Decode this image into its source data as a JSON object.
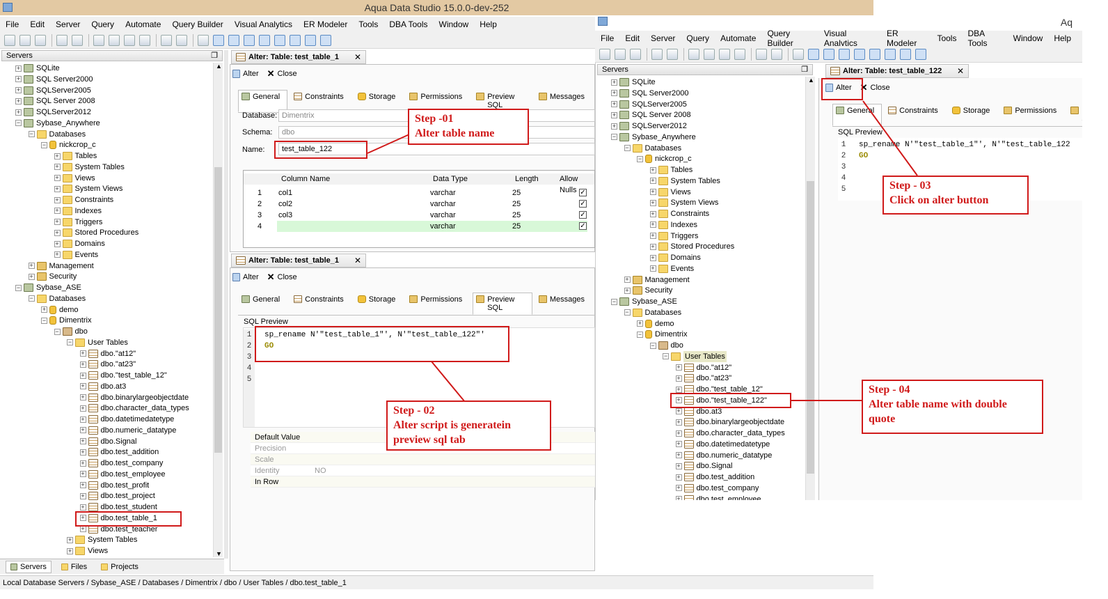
{
  "window_title": "Aqua Data Studio 15.0.0-dev-252",
  "window_title_right": "Aq",
  "menu": [
    "File",
    "Edit",
    "Server",
    "Query",
    "Automate",
    "Query Builder",
    "Visual Analytics",
    "ER Modeler",
    "Tools",
    "DBA Tools",
    "Window",
    "Help"
  ],
  "servers_panel_title": "Servers",
  "tree_left": [
    {
      "d": 0,
      "t": "SQLite",
      "i": "srv"
    },
    {
      "d": 0,
      "t": "SQL Server2000",
      "i": "srv"
    },
    {
      "d": 0,
      "t": "SQLServer2005",
      "i": "srv"
    },
    {
      "d": 0,
      "t": "SQL Server 2008",
      "i": "srv"
    },
    {
      "d": 0,
      "t": "SQLServer2012",
      "i": "srv"
    },
    {
      "d": 0,
      "t": "Sybase_Anywhere",
      "i": "srv",
      "open": true
    },
    {
      "d": 1,
      "t": "Databases",
      "i": "fld",
      "open": true
    },
    {
      "d": 2,
      "t": "nickcrop_c",
      "i": "db",
      "open": true
    },
    {
      "d": 3,
      "t": "Tables",
      "i": "fld"
    },
    {
      "d": 3,
      "t": "System Tables",
      "i": "fld"
    },
    {
      "d": 3,
      "t": "Views",
      "i": "fld"
    },
    {
      "d": 3,
      "t": "System Views",
      "i": "fld"
    },
    {
      "d": 3,
      "t": "Constraints",
      "i": "fld"
    },
    {
      "d": 3,
      "t": "Indexes",
      "i": "fld"
    },
    {
      "d": 3,
      "t": "Triggers",
      "i": "fld"
    },
    {
      "d": 3,
      "t": "Stored Procedures",
      "i": "fld"
    },
    {
      "d": 3,
      "t": "Domains",
      "i": "fld"
    },
    {
      "d": 3,
      "t": "Events",
      "i": "fld"
    },
    {
      "d": 1,
      "t": "Management",
      "i": "mgmt"
    },
    {
      "d": 1,
      "t": "Security",
      "i": "mgmt"
    },
    {
      "d": 0,
      "t": "Sybase_ASE",
      "i": "srv",
      "open": true
    },
    {
      "d": 1,
      "t": "Databases",
      "i": "fld",
      "open": true
    },
    {
      "d": 2,
      "t": "demo",
      "i": "db"
    },
    {
      "d": 2,
      "t": "Dimentrix",
      "i": "db",
      "open": true
    },
    {
      "d": 3,
      "t": "dbo",
      "i": "sch",
      "open": true
    },
    {
      "d": 4,
      "t": "User Tables",
      "i": "fld",
      "open": true
    },
    {
      "d": 5,
      "t": "dbo.\"at12\"",
      "i": "tbl"
    },
    {
      "d": 5,
      "t": "dbo.\"at23\"",
      "i": "tbl"
    },
    {
      "d": 5,
      "t": "dbo.\"test_table_12\"",
      "i": "tbl"
    },
    {
      "d": 5,
      "t": "dbo.at3",
      "i": "tbl"
    },
    {
      "d": 5,
      "t": "dbo.binarylargeobjectdate",
      "i": "tbl"
    },
    {
      "d": 5,
      "t": "dbo.character_data_types",
      "i": "tbl"
    },
    {
      "d": 5,
      "t": "dbo.datetimedatetype",
      "i": "tbl"
    },
    {
      "d": 5,
      "t": "dbo.numeric_datatype",
      "i": "tbl"
    },
    {
      "d": 5,
      "t": "dbo.Signal",
      "i": "tbl"
    },
    {
      "d": 5,
      "t": "dbo.test_addition",
      "i": "tbl"
    },
    {
      "d": 5,
      "t": "dbo.test_company",
      "i": "tbl"
    },
    {
      "d": 5,
      "t": "dbo.test_employee",
      "i": "tbl"
    },
    {
      "d": 5,
      "t": "dbo.test_profit",
      "i": "tbl"
    },
    {
      "d": 5,
      "t": "dbo.test_project",
      "i": "tbl"
    },
    {
      "d": 5,
      "t": "dbo.test_student",
      "i": "tbl"
    },
    {
      "d": 5,
      "t": "dbo.test_table_1",
      "i": "tbl"
    },
    {
      "d": 5,
      "t": "dbo.test_teacher",
      "i": "tbl"
    },
    {
      "d": 4,
      "t": "System Tables",
      "i": "fld"
    },
    {
      "d": 4,
      "t": "Views",
      "i": "fld"
    }
  ],
  "tree_right": [
    {
      "d": 0,
      "t": "SQLite",
      "i": "srv"
    },
    {
      "d": 0,
      "t": "SQL Server2000",
      "i": "srv"
    },
    {
      "d": 0,
      "t": "SQLServer2005",
      "i": "srv"
    },
    {
      "d": 0,
      "t": "SQL Server 2008",
      "i": "srv"
    },
    {
      "d": 0,
      "t": "SQLServer2012",
      "i": "srv"
    },
    {
      "d": 0,
      "t": "Sybase_Anywhere",
      "i": "srv",
      "open": true
    },
    {
      "d": 1,
      "t": "Databases",
      "i": "fld",
      "open": true
    },
    {
      "d": 2,
      "t": "nickcrop_c",
      "i": "db",
      "open": true
    },
    {
      "d": 3,
      "t": "Tables",
      "i": "fld"
    },
    {
      "d": 3,
      "t": "System Tables",
      "i": "fld"
    },
    {
      "d": 3,
      "t": "Views",
      "i": "fld"
    },
    {
      "d": 3,
      "t": "System Views",
      "i": "fld"
    },
    {
      "d": 3,
      "t": "Constraints",
      "i": "fld"
    },
    {
      "d": 3,
      "t": "Indexes",
      "i": "fld"
    },
    {
      "d": 3,
      "t": "Triggers",
      "i": "fld"
    },
    {
      "d": 3,
      "t": "Stored Procedures",
      "i": "fld"
    },
    {
      "d": 3,
      "t": "Domains",
      "i": "fld"
    },
    {
      "d": 3,
      "t": "Events",
      "i": "fld"
    },
    {
      "d": 1,
      "t": "Management",
      "i": "mgmt"
    },
    {
      "d": 1,
      "t": "Security",
      "i": "mgmt"
    },
    {
      "d": 0,
      "t": "Sybase_ASE",
      "i": "srv",
      "open": true
    },
    {
      "d": 1,
      "t": "Databases",
      "i": "fld",
      "open": true
    },
    {
      "d": 2,
      "t": "demo",
      "i": "db"
    },
    {
      "d": 2,
      "t": "Dimentrix",
      "i": "db",
      "open": true
    },
    {
      "d": 3,
      "t": "dbo",
      "i": "sch",
      "open": true
    },
    {
      "d": 4,
      "t": "User Tables",
      "i": "fld",
      "open": true,
      "sel": true
    },
    {
      "d": 5,
      "t": "dbo.\"at12\"",
      "i": "tbl"
    },
    {
      "d": 5,
      "t": "dbo.\"at23\"",
      "i": "tbl"
    },
    {
      "d": 5,
      "t": "dbo.\"test_table_12\"",
      "i": "tbl"
    },
    {
      "d": 5,
      "t": "dbo.\"test_table_122\"",
      "i": "tbl"
    },
    {
      "d": 5,
      "t": "dbo.at3",
      "i": "tbl"
    },
    {
      "d": 5,
      "t": "dbo.binarylargeobjectdate",
      "i": "tbl"
    },
    {
      "d": 5,
      "t": "dbo.character_data_types",
      "i": "tbl"
    },
    {
      "d": 5,
      "t": "dbo.datetimedatetype",
      "i": "tbl"
    },
    {
      "d": 5,
      "t": "dbo.numeric_datatype",
      "i": "tbl"
    },
    {
      "d": 5,
      "t": "dbo.Signal",
      "i": "tbl"
    },
    {
      "d": 5,
      "t": "dbo.test_addition",
      "i": "tbl"
    },
    {
      "d": 5,
      "t": "dbo.test_company",
      "i": "tbl"
    },
    {
      "d": 5,
      "t": "dbo.test_employee",
      "i": "tbl"
    }
  ],
  "alter_tab_title_1": "Alter: Table: test_table_1",
  "alter_tab_title_2": "Alter: Table: test_table_1",
  "alter_tab_title_3": "Alter: Table: test_table_122",
  "alter_label": "Alter",
  "close_label": "Close",
  "subtabs": [
    "General",
    "Constraints",
    "Storage",
    "Permissions",
    "Preview SQL",
    "Messages"
  ],
  "form": {
    "database_label": "Database:",
    "database_value": "Dimentrix",
    "schema_label": "Schema:",
    "schema_value": "dbo",
    "name_label": "Name:",
    "name_value": "test_table_122"
  },
  "columns": {
    "headers": [
      "Column Name",
      "Data Type",
      "Length",
      "Allow Nulls"
    ],
    "rows": [
      {
        "n": "1",
        "name": "col1",
        "type": "varchar",
        "len": "25",
        "nulls": true
      },
      {
        "n": "2",
        "name": "col2",
        "type": "varchar",
        "len": "25",
        "nulls": true
      },
      {
        "n": "3",
        "name": "col3",
        "type": "varchar",
        "len": "25",
        "nulls": true
      },
      {
        "n": "4",
        "name": "",
        "type": "varchar",
        "len": "25",
        "nulls": true
      }
    ]
  },
  "sql_preview_label": "SQL Preview",
  "sql_line1": "sp_rename N'\"test_table_1\"', N'\"test_table_122\"'",
  "sql_line1_right": "sp_rename N'\"test_table_1\"', N'\"test_table_122",
  "sql_line2": "GO",
  "line_numbers": [
    "1",
    "2",
    "3",
    "4",
    "5"
  ],
  "props": [
    {
      "k": "Default Value",
      "v": ""
    },
    {
      "k": "Precision",
      "v": ""
    },
    {
      "k": "Scale",
      "v": ""
    },
    {
      "k": "Identity",
      "v": "NO"
    },
    {
      "k": "In Row",
      "v": ""
    }
  ],
  "bottom_tabs": [
    "Servers",
    "Files",
    "Projects"
  ],
  "status_path": "Local Database Servers / Sybase_ASE / Databases / Dimentrix / dbo / User Tables / dbo.test_table_1",
  "notes": {
    "step1_a": "Step -01",
    "step1_b": "Alter table name",
    "step2_a": "Step - 02",
    "step2_b": "Alter script is generatein",
    "step2_c": "preview sql tab",
    "step3_a": "Step - 03",
    "step3_b": "Click on alter button",
    "step4_a": "Step - 04",
    "step4_b": "Alter table name with double",
    "step4_c": "quote"
  },
  "colors": {
    "annotation": "#d01a1a",
    "new_row": "#d8f8d8",
    "title_bar": "#e3c9a3"
  }
}
